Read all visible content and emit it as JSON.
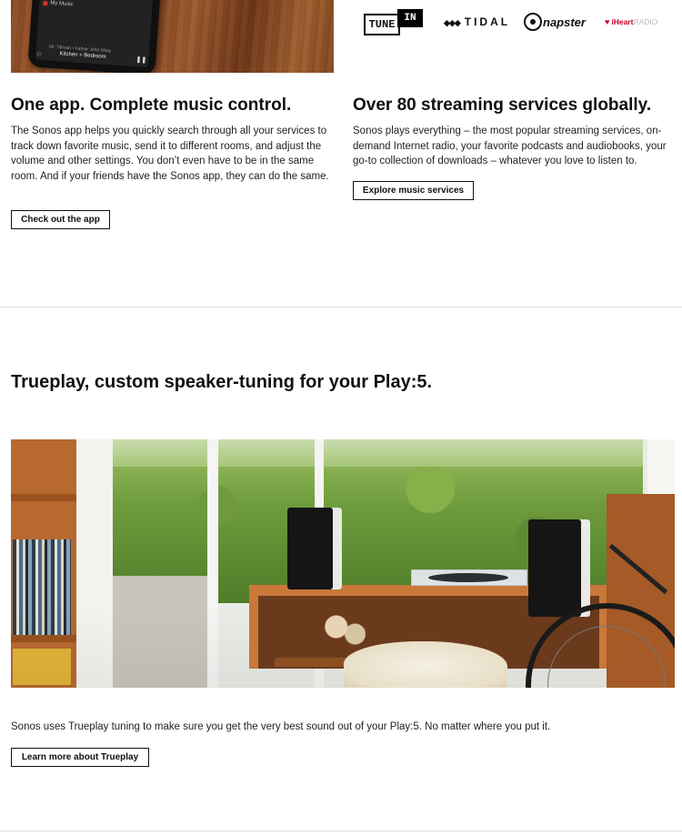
{
  "app_image": {
    "phone_menu_item": "My Music",
    "now_playing_line1": "Mr. Tillman • Father John Misty",
    "now_playing_line2": "Kitchen + Bedroom",
    "star_glyph": "☆",
    "pause_glyph": "❚❚"
  },
  "services": {
    "tunein_box": "TUNE",
    "tunein_in": "IN",
    "tidal_diamonds": "◆◆◆",
    "tidal": "TIDAL",
    "napster": "napster",
    "iheart_heart": "♥",
    "iheart_main": "iHeart",
    "iheart_radio": "RADIO"
  },
  "app_section": {
    "title": "One app. Complete music control.",
    "body": "The Sonos app helps you quickly search through all your services to track down favorite music, send it to different rooms, and adjust the volume and other settings. You don’t even have to be in the same room. And if your friends have the Sonos app, they can do the same.",
    "button": "Check out the app"
  },
  "streaming_section": {
    "title": "Over 80 streaming services globally.",
    "body": "Sonos plays everything – the most popular streaming services, on-demand Internet radio, your favorite podcasts and audiobooks, your go-to collection of downloads – whatever you love to listen to.",
    "button": "Explore music services"
  },
  "trueplay_section": {
    "title": "Trueplay, custom speaker-tuning for your Play:5.",
    "body": "Sonos uses Trueplay tuning to make sure you get the very best sound out of your Play:5. No matter where you put it.",
    "button": "Learn more about Trueplay"
  }
}
